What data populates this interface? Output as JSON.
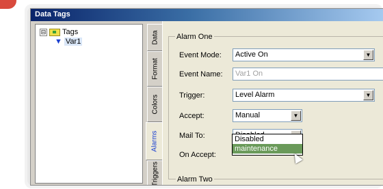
{
  "window": {
    "title": "Data Tags"
  },
  "tree": {
    "root": {
      "label": "Tags",
      "expander": "⊟"
    },
    "child": {
      "label": "Var1"
    }
  },
  "tabs": [
    "Data",
    "Format",
    "Colors",
    "Alarms",
    "Triggers"
  ],
  "active_tab": "Alarms",
  "alarm_one": {
    "group_label": "Alarm One",
    "event_mode": {
      "label": "Event Mode:",
      "value": "Active On"
    },
    "event_name": {
      "label": "Event Name:",
      "value": "Var1 On"
    },
    "trigger": {
      "label": "Trigger:",
      "value": "Level Alarm"
    },
    "accept": {
      "label": "Accept:",
      "value": "Manual"
    },
    "mail_to": {
      "label": "Mail To:",
      "value": "Disabled",
      "options": [
        "Disabled",
        "maintenance"
      ],
      "highlighted": "maintenance"
    },
    "on_accept": {
      "label": "On Accept:"
    }
  },
  "alarm_two": {
    "group_label": "Alarm Two"
  },
  "colors": {
    "accent": "#1a3fd0",
    "highlight": "#6a9a5a"
  }
}
